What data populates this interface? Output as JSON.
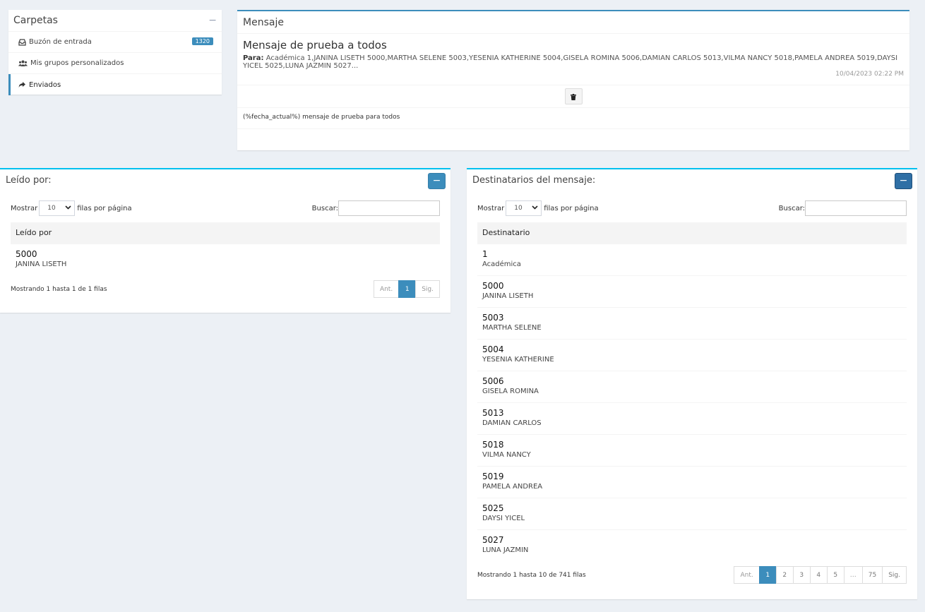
{
  "folders": {
    "title": "Carpetas",
    "collapse": "−",
    "items": [
      {
        "label": "Buzón de entrada",
        "icon": "inbox-icon",
        "badge": "1320"
      },
      {
        "label": "Mis grupos personalizados",
        "icon": "users-icon"
      },
      {
        "label": "Enviados",
        "icon": "share-icon"
      }
    ]
  },
  "message": {
    "header": "Mensaje",
    "subject": "Mensaje de prueba a todos",
    "to_label": "Para:",
    "to_list": "Académica 1,JANINA LISETH 5000,MARTHA SELENE 5003,YESENIA KATHERINE 5004,GISELA ROMINA 5006,DAMIAN CARLOS 5013,VILMA NANCY 5018,PAMELA ANDREA 5019,DAYSI YICEL 5025,LUNA JAZMIN 5027...",
    "date": "10/04/2023 02:22 PM",
    "body": "(%fecha_actual%) mensaje de prueba para todos"
  },
  "readby": {
    "title": "Leído por:",
    "show_label": "Mostrar",
    "page_size": "10",
    "rows_label": "filas por página",
    "search_label": "Buscar:",
    "column": "Leído por",
    "rows": [
      {
        "num": "5000",
        "name": "JANINA LISETH"
      }
    ],
    "footer_info": "Mostrando 1 hasta 1 de 1 filas",
    "pager": {
      "prev": "Ant.",
      "pages": [
        "1"
      ],
      "next": "Sig."
    }
  },
  "recipients": {
    "title": "Destinatarios del mensaje:",
    "show_label": "Mostrar",
    "page_size": "10",
    "rows_label": "filas por página",
    "search_label": "Buscar:",
    "column": "Destinatario",
    "rows": [
      {
        "num": "1",
        "name": "Académica"
      },
      {
        "num": "5000",
        "name": "JANINA LISETH"
      },
      {
        "num": "5003",
        "name": "MARTHA SELENE"
      },
      {
        "num": "5004",
        "name": "YESENIA KATHERINE"
      },
      {
        "num": "5006",
        "name": "GISELA ROMINA"
      },
      {
        "num": "5013",
        "name": "DAMIAN CARLOS"
      },
      {
        "num": "5018",
        "name": "VILMA NANCY"
      },
      {
        "num": "5019",
        "name": "PAMELA ANDREA"
      },
      {
        "num": "5025",
        "name": "DAYSI YICEL"
      },
      {
        "num": "5027",
        "name": "LUNA JAZMIN"
      }
    ],
    "footer_info": "Mostrando 1 hasta 10 de 741 filas",
    "pager": {
      "prev": "Ant.",
      "pages": [
        "1",
        "2",
        "3",
        "4",
        "5",
        "…",
        "75"
      ],
      "next": "Sig."
    }
  },
  "colors": {
    "accent": "#3c8dbc",
    "cyan": "#00c0ef",
    "background": "#ecf0f5"
  }
}
